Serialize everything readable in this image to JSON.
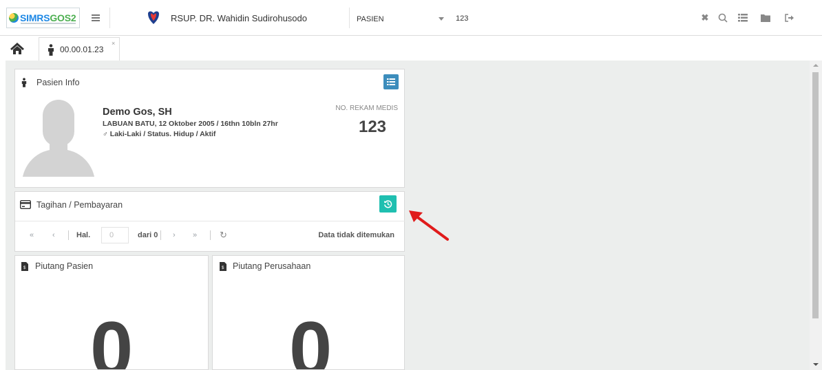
{
  "header": {
    "logo_text_a": "SIMRS",
    "logo_text_b": "GOS2",
    "hospital_name": "RSUP. DR. Wahidin Sudirohusodo",
    "search_type": "PASIEN",
    "search_value": "123"
  },
  "tabs": {
    "patient_tab_label": "00.00.01.23",
    "close_glyph": "×"
  },
  "patient_info": {
    "title": "Pasien Info",
    "name": "Demo Gos, SH",
    "birth": "LABUAN BATU, 12 Oktober 2005 / 16thn 10bln 27hr",
    "gender_status": "♂ Laki-Laki / Status. Hidup / Aktif",
    "record_label": "NO. REKAM MEDIS",
    "record_number": "123"
  },
  "billing": {
    "title": "Tagihan / Pembayaran",
    "page_label": "Hal.",
    "page_value": "0",
    "of_label": "dari 0",
    "empty_message": "Data tidak ditemukan"
  },
  "receivables": {
    "patient_title": "Piutang Pasien",
    "patient_value": "0",
    "company_title": "Piutang Perusahaan",
    "company_value": "0"
  },
  "colors": {
    "accent_blue": "#3c8dbc",
    "accent_teal": "#1fbfb0",
    "annotation_red": "#e01b1b"
  }
}
